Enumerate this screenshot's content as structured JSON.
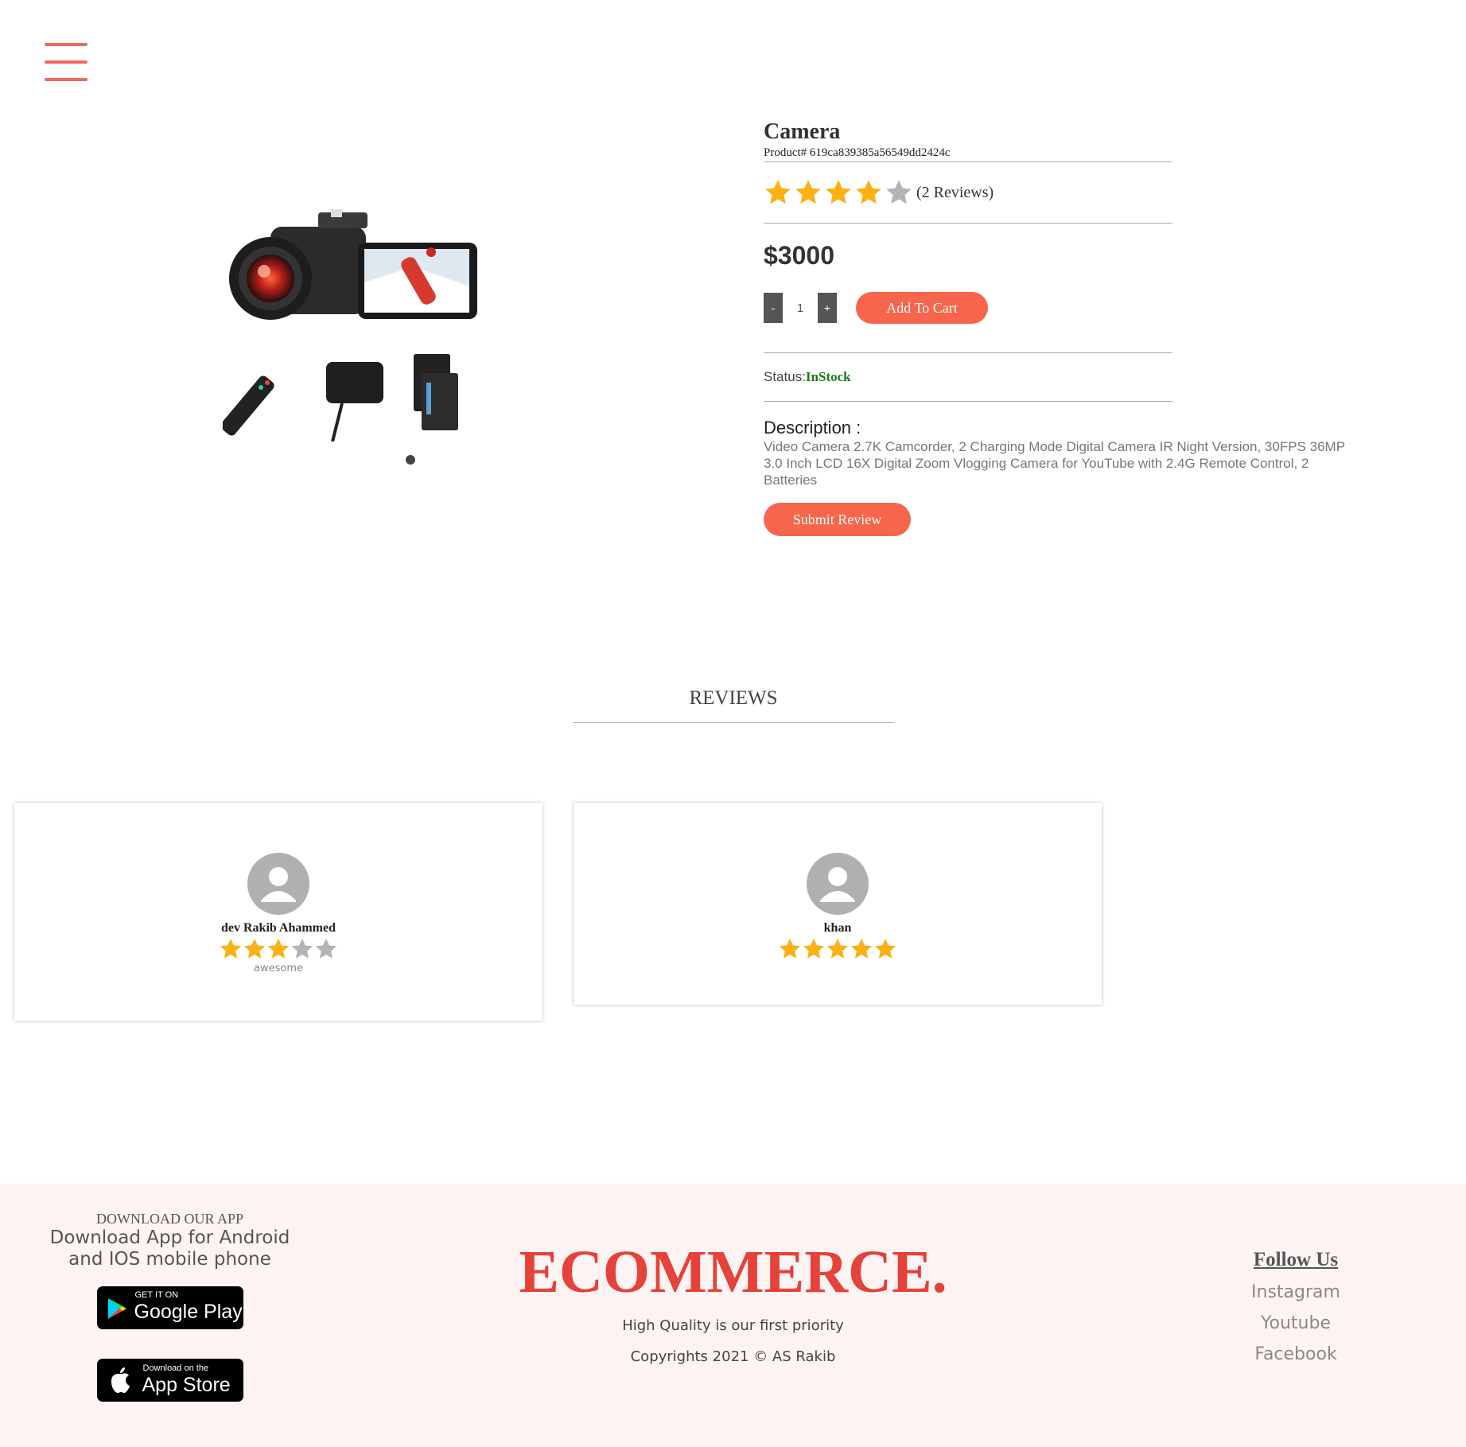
{
  "header": {
    "menu_icon": "hamburger-menu-icon"
  },
  "product": {
    "title": "Camera",
    "product_id_label": "Product#",
    "product_id": "619ca839385a56549dd2424c",
    "rating": 4,
    "rating_max": 5,
    "reviews_count_text": "(2 Reviews)",
    "price": "$3000",
    "quantity_decrement_label": "-",
    "quantity": "1",
    "quantity_increment_label": "+",
    "add_to_cart_label": "Add To Cart",
    "status_label": "Status:",
    "status_value": "InStock",
    "description_title": "Description :",
    "description_text": "Video Camera 2.7K Camcorder, 2 Charging Mode Digital Camera IR Night Version, 30FPS 36MP 3.0 Inch LCD 16X Digital Zoom Vlogging Camera for YouTube with 2.4G Remote Control, 2 Batteries",
    "submit_review_label": "Submit Review",
    "image_icon": "camcorder-product-image",
    "carousel_slide_count": 1
  },
  "reviews": {
    "heading": "REVIEWS",
    "items": [
      {
        "name": "dev Rakib Ahammed",
        "rating": 3,
        "comment": "awesome"
      },
      {
        "name": "khan",
        "rating": 5,
        "comment": ""
      }
    ]
  },
  "footer": {
    "app_heading": "DOWNLOAD OUR APP",
    "app_text": "Download App for Android and IOS mobile phone",
    "google_play": {
      "small": "GET IT ON",
      "big": "Google Play"
    },
    "app_store": {
      "small": "Download on the",
      "big": "App Store"
    },
    "brand": "ECOMMERCE.",
    "tagline": "High Quality is our first priority",
    "copyright": "Copyrights 2021 © AS Rakib",
    "follow_title": "Follow Us",
    "social": [
      "Instagram",
      "Youtube",
      "Facebook"
    ]
  },
  "colors": {
    "accent": "#f7664c",
    "brand": "#e4423a",
    "star_filled": "#fbb116",
    "star_empty": "#b4b4b4",
    "instock": "#1a7a1a",
    "footer_bg": "#fdf3f3"
  }
}
